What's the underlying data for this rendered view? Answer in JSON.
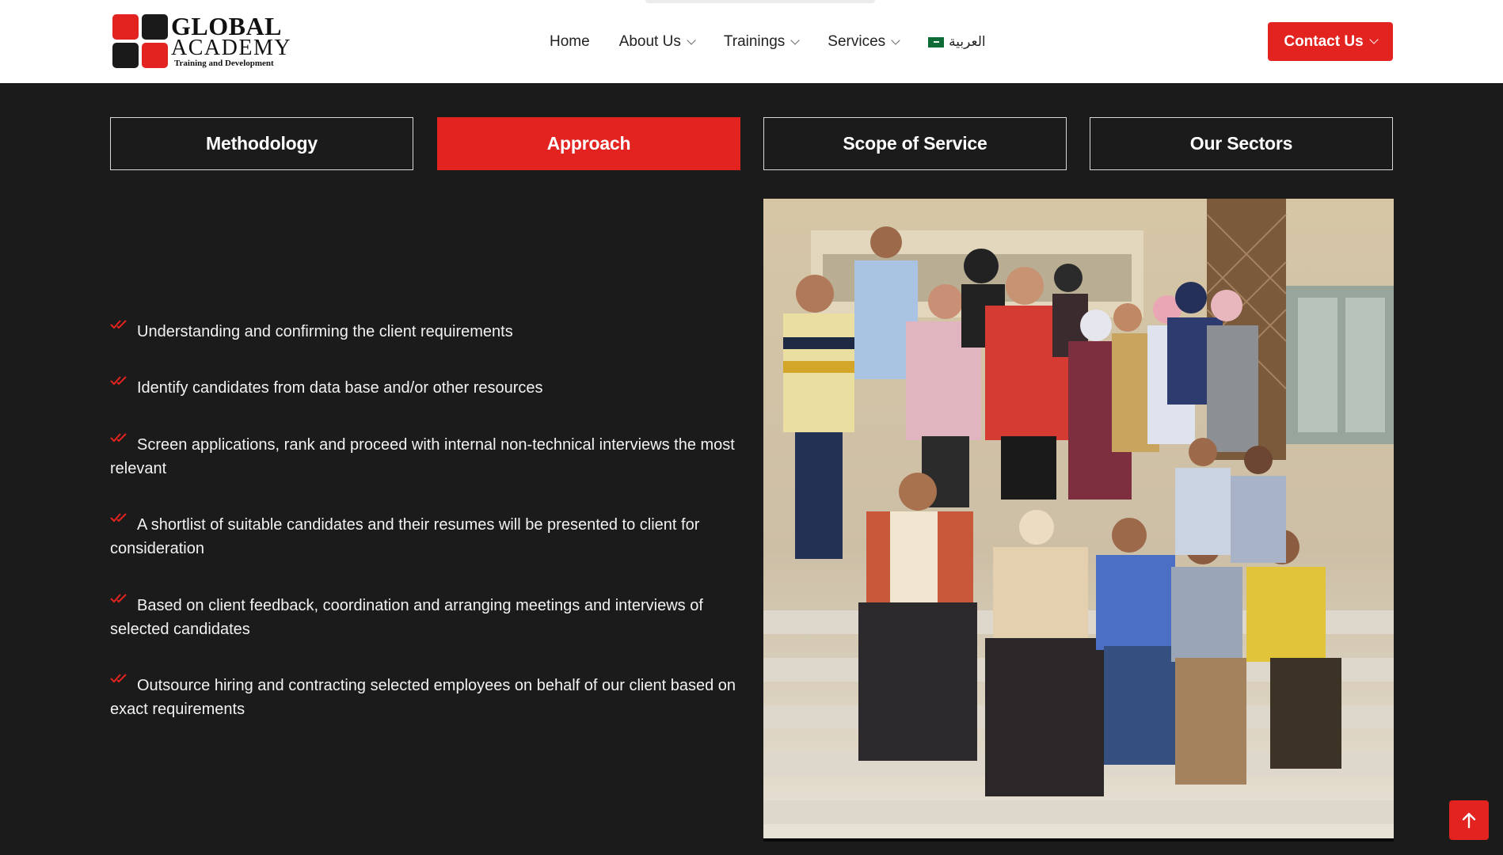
{
  "brand": {
    "line1": "GLOBAL",
    "line2": "ACADEMY",
    "line3": "Training and Development",
    "colors": {
      "red": "#e3231f",
      "dark": "#1a1a1a"
    }
  },
  "nav": {
    "items": [
      {
        "label": "Home",
        "icon": ""
      },
      {
        "label": "About Us",
        "icon": "chevron-down-icon"
      },
      {
        "label": "Trainings",
        "icon": "chevron-down-icon"
      },
      {
        "label": "Services",
        "icon": "chevron-down-icon"
      }
    ],
    "language": {
      "label": "العربية",
      "icon": "saudi-flag-icon"
    },
    "contact": {
      "label": "Contact Us",
      "icon": "chevron-down-icon"
    }
  },
  "tabs": [
    {
      "label": "Methodology",
      "active": false
    },
    {
      "label": "Approach",
      "active": true
    },
    {
      "label": "Scope of Service",
      "active": false
    },
    {
      "label": "Our Sectors",
      "active": false
    }
  ],
  "approach": {
    "items": [
      "Understanding and confirming the client requirements",
      "Identify candidates from data base and/or other resources",
      "Screen applications, rank and proceed with internal non-technical interviews the most relevant",
      "A shortlist of suitable candidates and their resumes will be presented to client for consideration",
      "Based on client feedback, coordination and arranging meetings and interviews of selected candidates",
      "Outsource hiring and contracting selected employees on behalf of our client based on exact requirements"
    ],
    "bullet_icon": "double-check-icon"
  },
  "scroll_top": {
    "icon": "arrow-up-icon"
  },
  "theme": {
    "background": "#1c1b1c",
    "accent": "#e3231f",
    "header": "#ffffff"
  }
}
